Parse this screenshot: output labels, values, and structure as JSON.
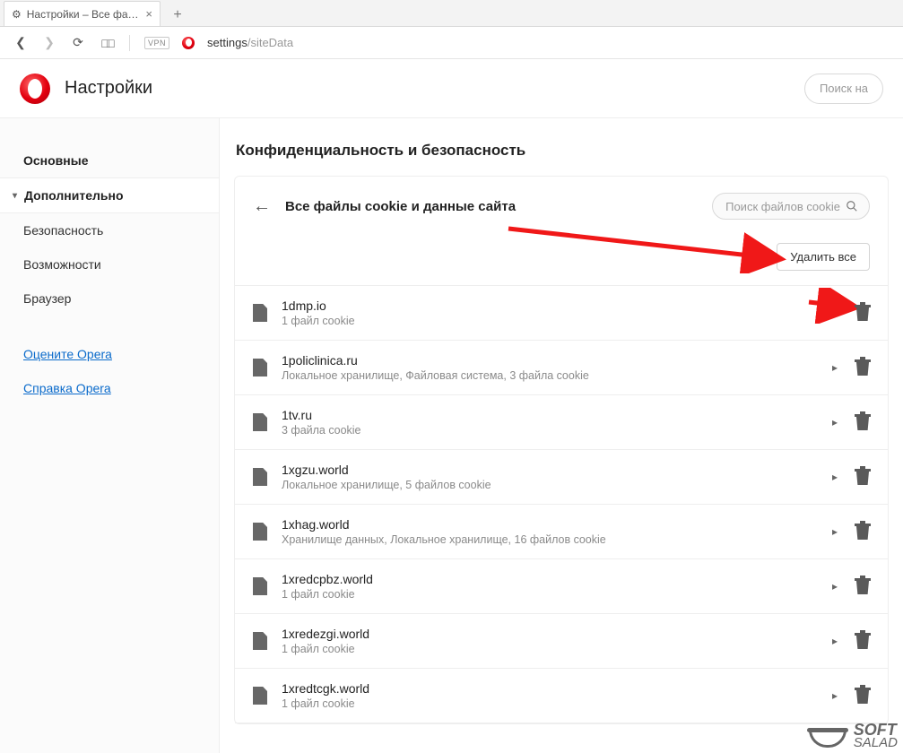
{
  "tabs": {
    "active_title": "Настройки – Все файлы c",
    "close_glyph": "×",
    "new_glyph": "+"
  },
  "toolbar": {
    "vpn_label": "VPN",
    "url_prefix": "settings",
    "url_suffix": "/siteData"
  },
  "header": {
    "title": "Настройки",
    "search_placeholder": "Поиск на"
  },
  "sidebar": {
    "items": [
      {
        "label": "Основные",
        "kind": "bold"
      },
      {
        "label": "Дополнительно",
        "kind": "active"
      },
      {
        "label": "Безопасность",
        "kind": "sub"
      },
      {
        "label": "Возможности",
        "kind": "sub"
      },
      {
        "label": "Браузер",
        "kind": "sub"
      }
    ],
    "links": [
      {
        "label": "Оцените Opera"
      },
      {
        "label": "Справка Opera"
      }
    ]
  },
  "section_title": "Конфиденциальность и безопасность",
  "card": {
    "title": "Все файлы cookie и данные сайта",
    "search_placeholder": "Поиск файлов cookie",
    "delete_all": "Удалить все"
  },
  "sites": [
    {
      "name": "1dmp.io",
      "meta": "1 файл cookie",
      "expandable": false
    },
    {
      "name": "1policlinica.ru",
      "meta": "Локальное хранилище, Файловая система, 3 файла cookie",
      "expandable": true
    },
    {
      "name": "1tv.ru",
      "meta": "3 файла cookie",
      "expandable": true
    },
    {
      "name": "1xgzu.world",
      "meta": "Локальное хранилище, 5 файлов cookie",
      "expandable": true
    },
    {
      "name": "1xhag.world",
      "meta": "Хранилище данных, Локальное хранилище, 16 файлов cookie",
      "expandable": true
    },
    {
      "name": "1xredcpbz.world",
      "meta": "1 файл cookie",
      "expandable": true
    },
    {
      "name": "1xredezgi.world",
      "meta": "1 файл cookie",
      "expandable": true
    },
    {
      "name": "1xredtcgk.world",
      "meta": "1 файл cookie",
      "expandable": true
    }
  ],
  "watermark": {
    "line1": "SOFT",
    "line2": "SALAD"
  }
}
